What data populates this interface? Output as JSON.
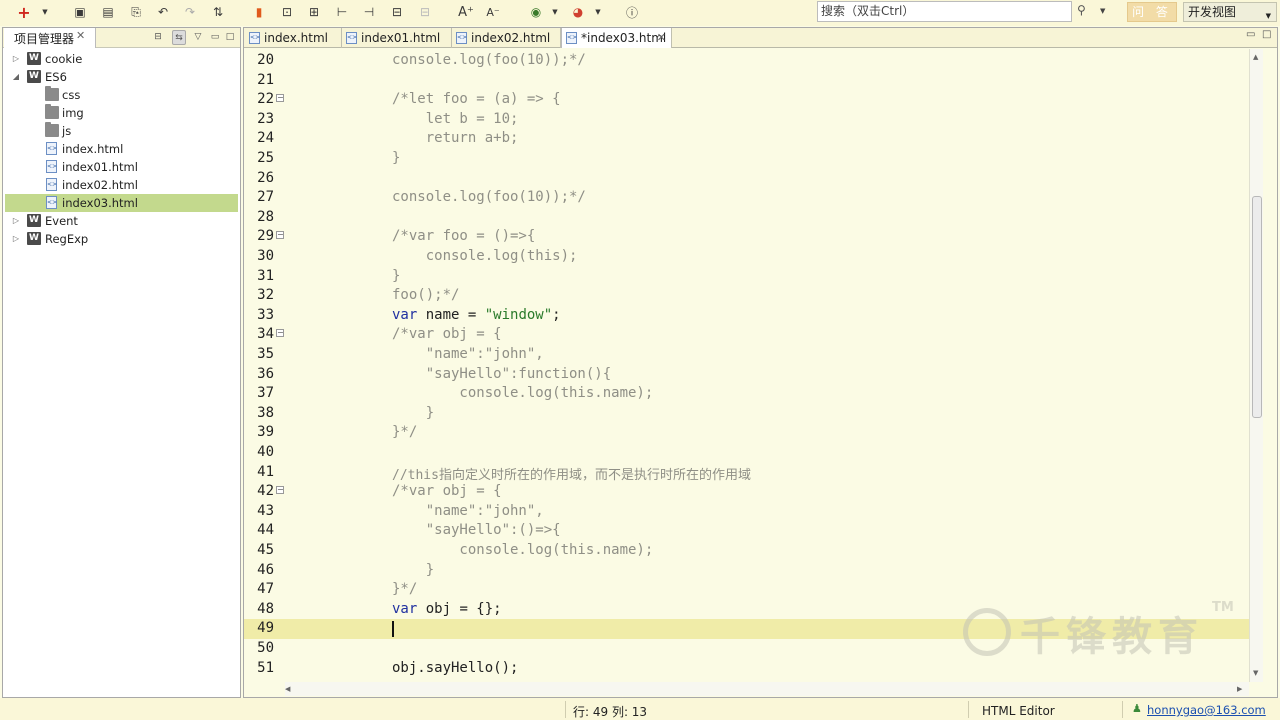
{
  "toolbar": {
    "search_placeholder": "搜索（双击Ctrl）",
    "ask_label": "问 答",
    "perspective_label": "开发视图"
  },
  "explorer": {
    "title": "项目管理器",
    "items": [
      {
        "label": "cookie"
      },
      {
        "label": "ES6"
      },
      {
        "label": "css"
      },
      {
        "label": "img"
      },
      {
        "label": "js"
      },
      {
        "label": "index.html"
      },
      {
        "label": "index01.html"
      },
      {
        "label": "index02.html"
      },
      {
        "label": "index03.html"
      },
      {
        "label": "Event"
      },
      {
        "label": "RegExp"
      }
    ]
  },
  "editor": {
    "tabs": [
      {
        "label": "index.html"
      },
      {
        "label": "index01.html"
      },
      {
        "label": "index02.html"
      },
      {
        "label": "*index03.html"
      }
    ],
    "lines": [
      {
        "n": "20",
        "text": "console.log(foo(10));*/"
      },
      {
        "n": "21",
        "text": ""
      },
      {
        "n": "22",
        "text": "/*let foo = (a) => {"
      },
      {
        "n": "23",
        "text": "    let b = 10;"
      },
      {
        "n": "24",
        "text": "    return a+b;"
      },
      {
        "n": "25",
        "text": "}"
      },
      {
        "n": "26",
        "text": ""
      },
      {
        "n": "27",
        "text": "console.log(foo(10));*/"
      },
      {
        "n": "28",
        "text": ""
      },
      {
        "n": "29",
        "text": "/*var foo = ()=>{"
      },
      {
        "n": "30",
        "text": "    console.log(this);"
      },
      {
        "n": "31",
        "text": "}"
      },
      {
        "n": "32",
        "text": "foo();*/"
      },
      {
        "n": "33",
        "text_var": "var",
        "text_name": " name = ",
        "text_str": "\"window\"",
        "text_end": ";"
      },
      {
        "n": "34",
        "text": "/*var obj = {"
      },
      {
        "n": "35",
        "text": "    \"name\":\"john\","
      },
      {
        "n": "36",
        "text": "    \"sayHello\":function(){"
      },
      {
        "n": "37",
        "text": "        console.log(this.name);"
      },
      {
        "n": "38",
        "text": "    }"
      },
      {
        "n": "39",
        "text": "}*/"
      },
      {
        "n": "40",
        "text": ""
      },
      {
        "n": "41",
        "text": "//this指向定义时所在的作用域，而不是执行时所在的作用域"
      },
      {
        "n": "42",
        "text": "/*var obj = {"
      },
      {
        "n": "43",
        "text": "    \"name\":\"john\","
      },
      {
        "n": "44",
        "text": "    \"sayHello\":()=>{"
      },
      {
        "n": "45",
        "text": "        console.log(this.name);"
      },
      {
        "n": "46",
        "text": "    }"
      },
      {
        "n": "47",
        "text": "}*/"
      },
      {
        "n": "48",
        "text_var": "var",
        "text_rest": " obj = {};"
      },
      {
        "n": "49",
        "text": ""
      },
      {
        "n": "50",
        "text": ""
      },
      {
        "n": "51",
        "text": "obj.sayHello();"
      }
    ]
  },
  "status": {
    "position": "行: 49 列: 13",
    "editor_type": "HTML Editor",
    "user": "honnygao@163.com"
  },
  "watermark": {
    "text": "千锋教育",
    "tm": "TM"
  },
  "colors": {
    "background": "#fbfbe4",
    "current_line": "#f0eca8",
    "selection": "#c3d98d",
    "comment": "#8f8f86",
    "string": "#2a7a2a",
    "keyword": "#2030a0"
  }
}
